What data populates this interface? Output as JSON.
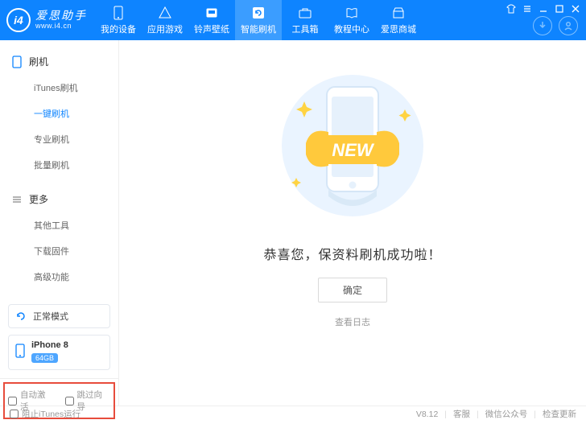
{
  "brand": {
    "logo": "i4",
    "name": "爱思助手",
    "url": "www.i4.cn"
  },
  "navs": [
    {
      "label": "我的设备"
    },
    {
      "label": "应用游戏"
    },
    {
      "label": "铃声壁纸"
    },
    {
      "label": "智能刷机"
    },
    {
      "label": "工具箱"
    },
    {
      "label": "教程中心"
    },
    {
      "label": "爱思商城"
    }
  ],
  "sidebar": {
    "groups": [
      {
        "title": "刷机",
        "items": [
          "iTunes刷机",
          "一键刷机",
          "专业刷机",
          "批量刷机"
        ]
      },
      {
        "title": "更多",
        "items": [
          "其他工具",
          "下载固件",
          "高级功能"
        ]
      }
    ]
  },
  "status": {
    "mode": "正常模式"
  },
  "device": {
    "name": "iPhone 8",
    "storage": "64GB"
  },
  "options": {
    "auto_activate": "自动激活",
    "skip_guide": "跳过向导"
  },
  "main": {
    "banner_label": "NEW",
    "success": "恭喜您，保资料刷机成功啦！",
    "ok": "确定",
    "view_log": "查看日志"
  },
  "footer": {
    "block_itunes": "阻止iTunes运行",
    "version": "V8.12",
    "support": "客服",
    "wechat": "微信公众号",
    "update": "检查更新"
  }
}
